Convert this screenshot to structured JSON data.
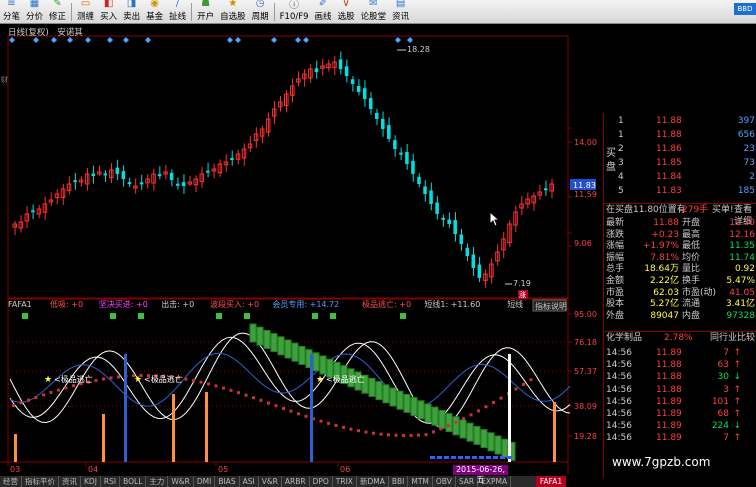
{
  "toolbar": {
    "buttons": [
      {
        "label": "分笔",
        "icon": "list-icon"
      },
      {
        "label": "分价",
        "icon": "grid-icon"
      },
      {
        "label": "修正",
        "icon": "edit-icon"
      },
      {
        "label": "测缠",
        "icon": "ruler-icon"
      },
      {
        "label": "买入",
        "icon": "buy-icon"
      },
      {
        "label": "卖出",
        "icon": "sell-icon"
      },
      {
        "label": "基金",
        "icon": "fund-icon"
      },
      {
        "label": "扯线",
        "icon": "line-icon"
      },
      {
        "label": "开户",
        "icon": "account-icon"
      },
      {
        "label": "自选股",
        "icon": "star-icon"
      },
      {
        "label": "周期",
        "icon": "period-icon"
      },
      {
        "label": "F10/F9",
        "icon": "info-icon"
      },
      {
        "label": "画线",
        "icon": "pen-icon"
      },
      {
        "label": "选股",
        "icon": "filter-icon"
      },
      {
        "label": "论股堂",
        "icon": "chat-icon"
      },
      {
        "label": "资讯",
        "icon": "news-icon"
      }
    ],
    "bbd_label": "BBD"
  },
  "chart_header": {
    "mode": "日线(复权)",
    "name": "安诺其"
  },
  "main_chart": {
    "price_labels": [
      "14.00",
      "11.59",
      "9.06"
    ],
    "current_price_tag": "11.83",
    "high_label": "18.28",
    "low_label": "7.19",
    "zhang_label": "涨",
    "left_edge_label": "财"
  },
  "indicator": {
    "header_items": [
      "FAFA1",
      "低吸: +0",
      "坚决买进: +0",
      "出击: +0",
      "波段买入: +0",
      "会员专用: +14.72",
      "极品逃亡: +0",
      "短线1: +11.60",
      "短线"
    ],
    "button_label": "指标说明",
    "axis_labels": [
      "95.00",
      "76.18",
      "57.37",
      "38.09",
      "19.28"
    ],
    "annotations": [
      "极品逃亡",
      "极品逃亡",
      "极品逃亡"
    ],
    "date_badge": "2015-06-26,五"
  },
  "x_axis_labels": [
    "03",
    "04",
    "05",
    "06"
  ],
  "order_book": {
    "side_label_sell": "卖盘",
    "side_label_buy": "买盘",
    "sell": [
      {
        "level": "1",
        "price": "11.88",
        "vol": "397",
        "blue": true
      },
      {
        "level": "1",
        "price": "11.88",
        "vol": "656",
        "blue": true
      },
      {
        "level": "2",
        "price": "11.86",
        "vol": "23",
        "blue": true
      },
      {
        "level": "3",
        "price": "11.85",
        "vol": "73",
        "blue": true
      },
      {
        "level": "4",
        "price": "11.84",
        "vol": "2",
        "blue": true
      },
      {
        "level": "5",
        "price": "11.83",
        "vol": "185",
        "blue": true
      }
    ],
    "status_line": {
      "text": "在买盘11.80位置有",
      "count": "279手",
      "buy1": "买单!",
      "detail": "查看详细"
    }
  },
  "quote_grid": [
    {
      "l": "最新",
      "v1": "11.88",
      "l2": "开盘",
      "v2": "11.70"
    },
    {
      "l": "涨跌",
      "v1": "+0.23",
      "l2": "最高",
      "v2": "12.16"
    },
    {
      "l": "涨幅",
      "v1": "+1.97%",
      "l2": "最低",
      "v2": "11.35"
    },
    {
      "l": "振幅",
      "v1": "7.81%",
      "l2": "均价",
      "v2": "11.74"
    },
    {
      "l": "总手",
      "v1": "18.64万",
      "l2": "量比",
      "v2": "0.92"
    },
    {
      "l": "金额",
      "v1": "2.22亿",
      "l2": "换手",
      "v2": "5.47%"
    },
    {
      "l": "市盈",
      "v1": "62.03",
      "l2": "市盈(动)",
      "v2": "41.05"
    },
    {
      "l": "股本",
      "v1": "5.27亿",
      "l2": "流通",
      "v2": "3.41亿"
    },
    {
      "l": "外盘",
      "v1": "89047",
      "l2": "内盘",
      "v2": "97328"
    }
  ],
  "sector": {
    "name": "化学制品",
    "change": "2.78%",
    "compare": "同行业比较"
  },
  "ticks": [
    {
      "time": "14:56",
      "price": "11.89",
      "vol": "7",
      "dir": "up"
    },
    {
      "time": "14:56",
      "price": "11.88",
      "vol": "63",
      "dir": "up"
    },
    {
      "time": "14:56",
      "price": "11.88",
      "vol": "30",
      "dir": "down"
    },
    {
      "time": "14:56",
      "price": "11.88",
      "vol": "3",
      "dir": "up"
    },
    {
      "time": "14:56",
      "price": "11.89",
      "vol": "101",
      "dir": "up"
    },
    {
      "time": "14:56",
      "price": "11.89",
      "vol": "68",
      "dir": "up"
    },
    {
      "time": "14:56",
      "price": "11.89",
      "vol": "224",
      "dir": "down"
    },
    {
      "time": "14:56",
      "price": "11.89",
      "vol": "7",
      "dir": "up"
    }
  ],
  "bottom_tabs": [
    "经营",
    "指标平价",
    "资讯",
    "KDJ",
    "RSI",
    "BOLL",
    "主力",
    "W&R",
    "DMI",
    "BIAS",
    "ASI",
    "V&R",
    "ARBR",
    "DPO",
    "TRIX",
    "新DMA",
    "BBI",
    "MTM",
    "OBV",
    "SAR",
    "EXPMA"
  ],
  "bottom_tab_active": "FAFA1",
  "watermark": "www.7gpzb.com",
  "colors": {
    "up": "#ff3030",
    "down": "#00e0e0",
    "accent": "#880000"
  },
  "chart_data": {
    "type": "candlestick",
    "x": [
      "03",
      "04",
      "05",
      "06"
    ],
    "ohlc_note": "Daily candles",
    "annotated_values": {
      "high": 18.28,
      "low": 7.19,
      "last": 11.83
    }
  }
}
